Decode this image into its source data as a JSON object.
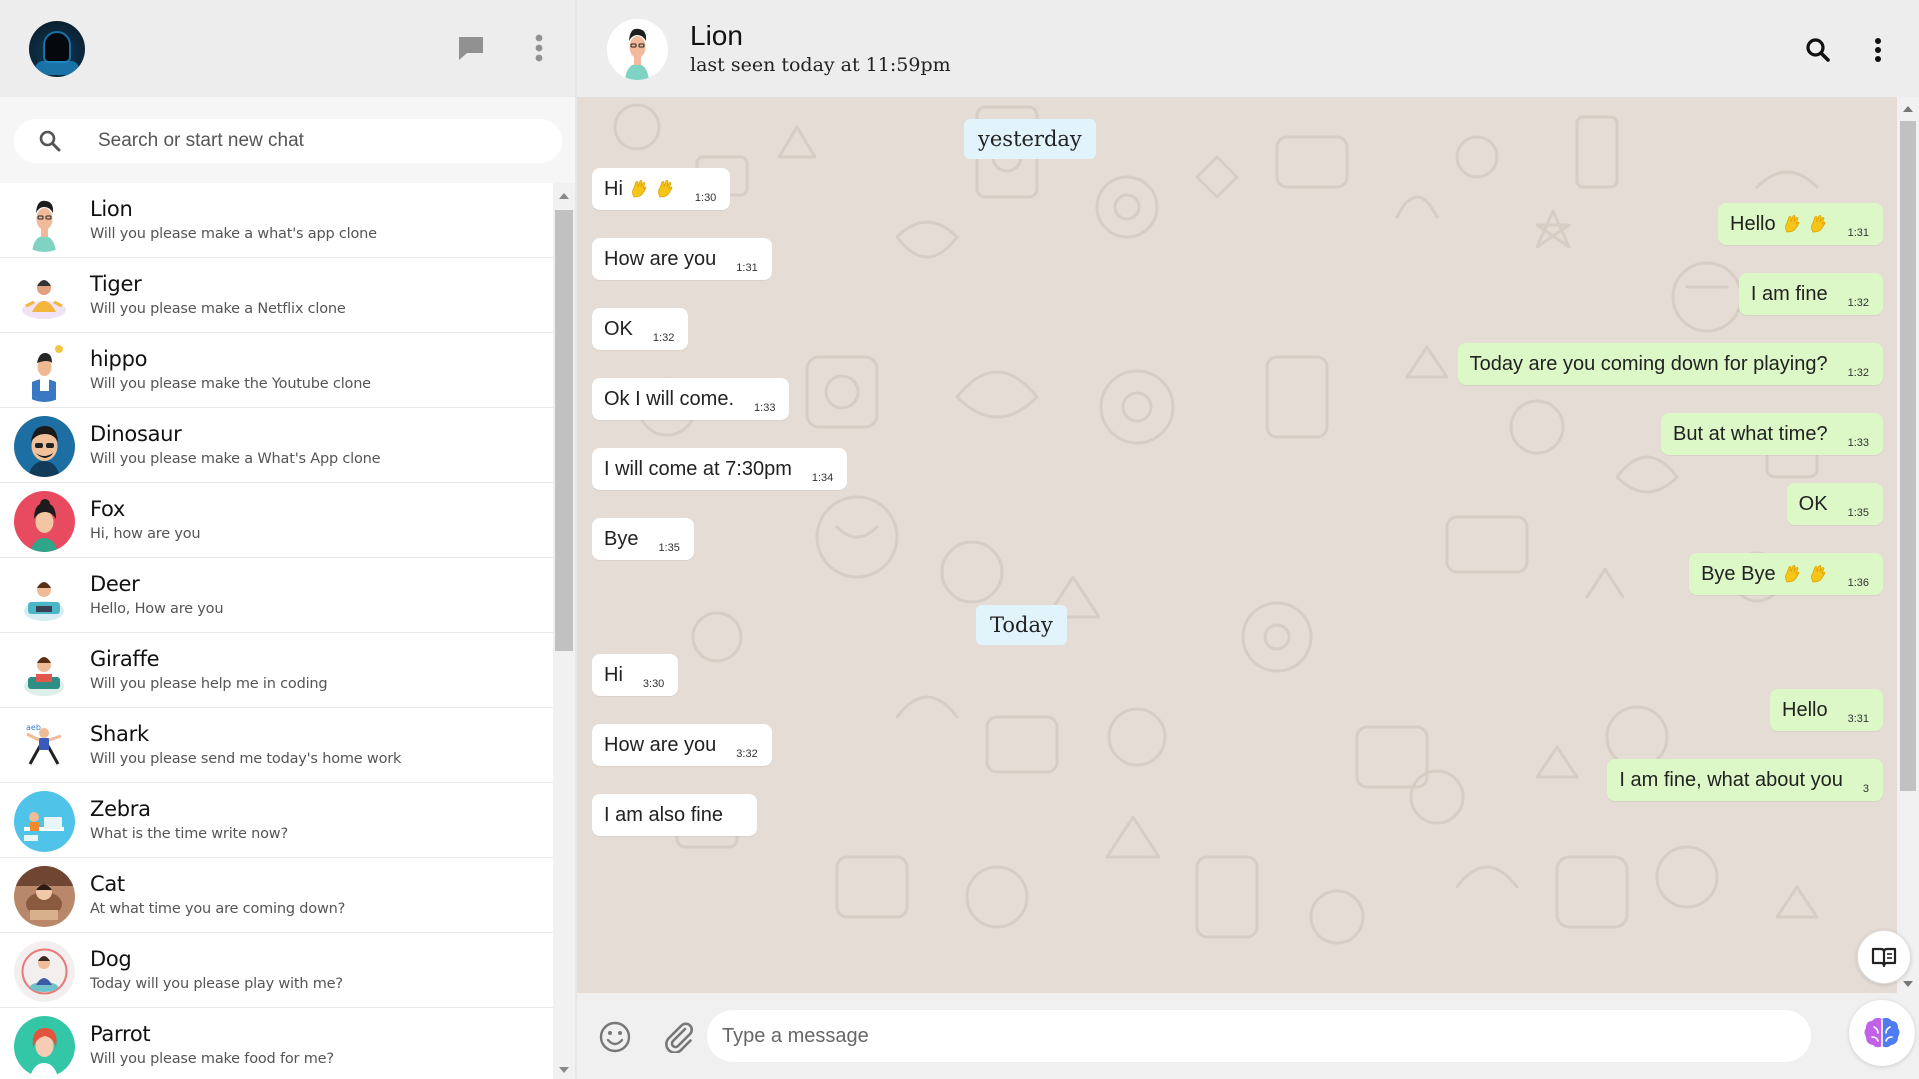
{
  "sidebar": {
    "search": {
      "placeholder": "Search or start new chat"
    },
    "chats": [
      {
        "name": "Lion",
        "message": "Will you please make a what's app clone"
      },
      {
        "name": "Tiger",
        "message": "Will you please make a Netflix clone"
      },
      {
        "name": "hippo",
        "message": "Will you please make the Youtube clone"
      },
      {
        "name": "Dinosaur",
        "message": "Will you please make a What's App clone"
      },
      {
        "name": "Fox",
        "message": "Hi, how are you"
      },
      {
        "name": "Deer",
        "message": "Hello, How are you"
      },
      {
        "name": "Giraffe",
        "message": "Will you please help me in coding"
      },
      {
        "name": "Shark",
        "message": "Will you please send me today's home work"
      },
      {
        "name": "Zebra",
        "message": "What is the time write now?"
      },
      {
        "name": "Cat",
        "message": "At what time you are coming down?"
      },
      {
        "name": "Dog",
        "message": "Today will you please play with me?"
      },
      {
        "name": "Parrot",
        "message": "Will you please make food for me?"
      }
    ]
  },
  "chat": {
    "contact_name": "Lion",
    "last_seen": "last seen today at 11:59pm",
    "dates": [
      "yesterday",
      "Today"
    ],
    "messages": [
      {
        "text": "Hi",
        "time": "1:30"
      },
      {
        "text": "Hello",
        "time": "1:31"
      },
      {
        "text": "How are you",
        "time": "1:31"
      },
      {
        "text": "I am fine",
        "time": "1:32"
      },
      {
        "text": "OK",
        "time": "1:32"
      },
      {
        "text": "Today are you coming down for playing?",
        "time": "1:32"
      },
      {
        "text": "Ok I will come.",
        "time": "1:33"
      },
      {
        "text": "But at what time?",
        "time": "1:33"
      },
      {
        "text": "I will come at 7:30pm",
        "time": "1:34"
      },
      {
        "text": "OK",
        "time": "1:35"
      },
      {
        "text": "Bye",
        "time": "1:35"
      },
      {
        "text": "Bye Bye",
        "time": "1:36"
      },
      {
        "text": "Hi",
        "time": "3:30"
      },
      {
        "text": "Hello",
        "time": "3:31"
      },
      {
        "text": "How are you",
        "time": "3:32"
      },
      {
        "text": "I am fine, what about you",
        "time": "3"
      },
      {
        "text": "I am also fine",
        "time": ""
      }
    ]
  },
  "composer": {
    "placeholder": "Type a message"
  },
  "icons": {
    "new_chat": "chat-bubble-icon",
    "menu": "kebab-menu-icon",
    "search": "search-icon",
    "emoji": "smiley-icon",
    "attach": "paperclip-icon",
    "assistant": "brain-icon",
    "reader": "open-book-icon"
  },
  "colors": {
    "header_bg": "#ededed",
    "chat_bg": "#e5ddd5",
    "outgoing_bubble": "#dcf8c6",
    "incoming_bubble": "#ffffff",
    "date_chip": "#e1f3fb",
    "wave_emoji": "#f5c518"
  }
}
